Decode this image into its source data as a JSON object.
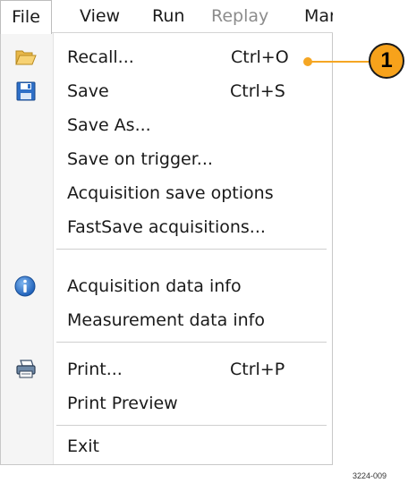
{
  "menubar": {
    "items": [
      {
        "label": "File",
        "state": "active"
      },
      {
        "label": "View"
      },
      {
        "label": "Run"
      },
      {
        "label": "Replay",
        "state": "disabled"
      },
      {
        "label": "Mar"
      }
    ]
  },
  "file_menu": {
    "items": [
      {
        "label": "Recall...",
        "shortcut": "Ctrl+O",
        "icon": "folder-open-icon"
      },
      {
        "label": "Save",
        "shortcut": "Ctrl+S",
        "icon": "floppy-disk-icon"
      },
      {
        "label": "Save As..."
      },
      {
        "label": "Save on trigger..."
      },
      {
        "label": "Acquisition save options"
      },
      {
        "label": "FastSave acquisitions..."
      },
      {
        "label": "Acquisition data info",
        "icon": "info-icon"
      },
      {
        "label": "Measurement data info"
      },
      {
        "label": "Print...",
        "shortcut": "Ctrl+P",
        "icon": "printer-icon"
      },
      {
        "label": "Print Preview"
      },
      {
        "label": "Exit"
      }
    ]
  },
  "callout": {
    "number": "1",
    "color": "#f7a21b"
  },
  "figure_id": "3224-009"
}
